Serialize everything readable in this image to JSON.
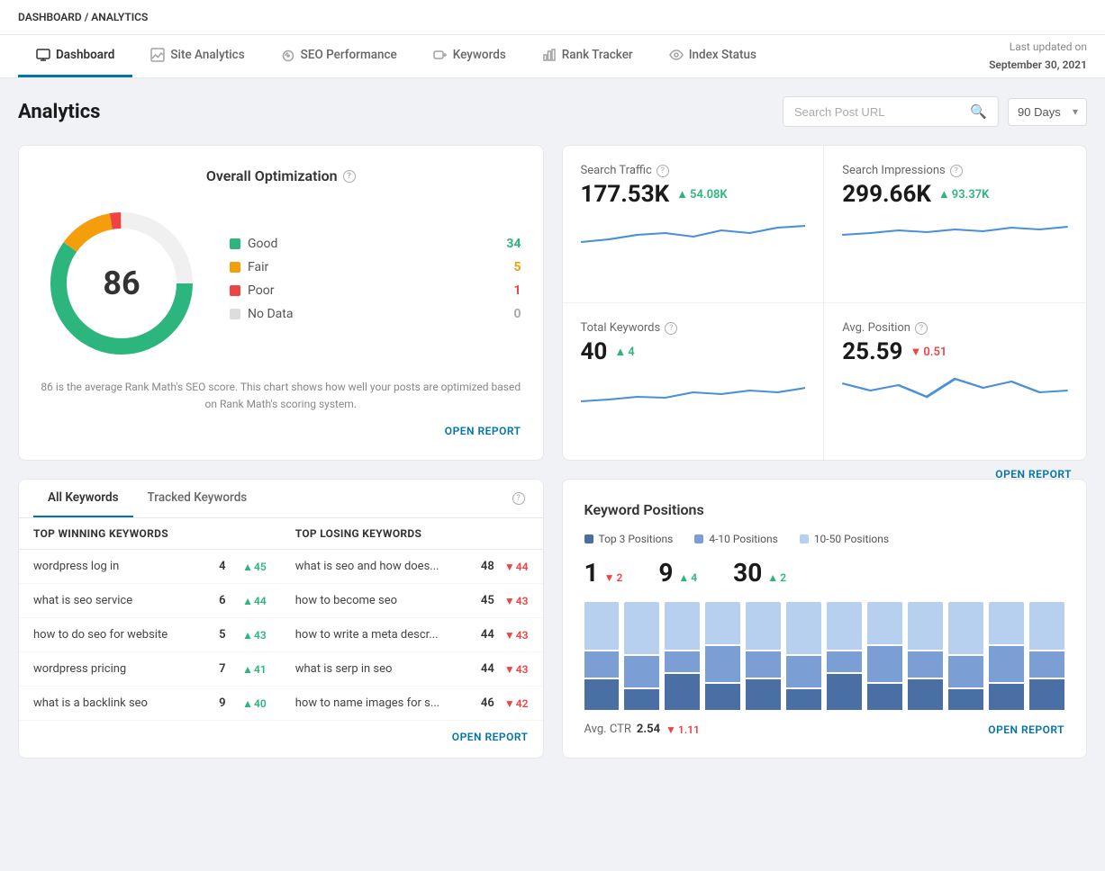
{
  "breadcrumb": {
    "dashboard": "DASHBOARD",
    "separator": "/",
    "current": "ANALYTICS"
  },
  "nav": {
    "tabs": [
      {
        "id": "dashboard",
        "label": "Dashboard",
        "icon": "monitor",
        "active": true
      },
      {
        "id": "site-analytics",
        "label": "Site Analytics",
        "icon": "chart",
        "active": false
      },
      {
        "id": "seo-performance",
        "label": "SEO Performance",
        "icon": "gauge",
        "active": false
      },
      {
        "id": "keywords",
        "label": "Keywords",
        "icon": "key",
        "active": false
      },
      {
        "id": "rank-tracker",
        "label": "Rank Tracker",
        "icon": "bar",
        "active": false
      },
      {
        "id": "index-status",
        "label": "Index Status",
        "icon": "eye",
        "active": false
      }
    ],
    "lastUpdated": {
      "label": "Last updated on",
      "date": "September 30, 2021"
    }
  },
  "page": {
    "title": "Analytics"
  },
  "search": {
    "placeholder": "Search Post URL"
  },
  "daysSelect": {
    "value": "90 Days"
  },
  "optimization": {
    "title": "Overall Optimization",
    "score": "86",
    "legend": [
      {
        "label": "Good",
        "count": "34",
        "color": "#2cb67d",
        "countClass": "green"
      },
      {
        "label": "Fair",
        "count": "5",
        "color": "#f59e0b",
        "countClass": "orange"
      },
      {
        "label": "Poor",
        "count": "1",
        "color": "#ef4444",
        "countClass": "red"
      },
      {
        "label": "No Data",
        "count": "0",
        "color": "#ddd",
        "countClass": "gray"
      }
    ],
    "description": "86 is the average Rank Math's SEO score. This chart shows how well your posts are optimized based on Rank Math's scoring system.",
    "openReport": "OPEN REPORT"
  },
  "searchTraffic": {
    "label": "Search Traffic",
    "value": "177.53K",
    "change": "54.08K",
    "changeDir": "up"
  },
  "searchImpressions": {
    "label": "Search Impressions",
    "value": "299.66K",
    "change": "93.37K",
    "changeDir": "up"
  },
  "totalKeywords": {
    "label": "Total Keywords",
    "value": "40",
    "change": "4",
    "changeDir": "up"
  },
  "avgPosition": {
    "label": "Avg. Position",
    "value": "25.59",
    "change": "0.51",
    "changeDir": "down"
  },
  "openReport": "OPEN REPORT",
  "keywords": {
    "tabs": [
      "All Keywords",
      "Tracked Keywords"
    ],
    "activeTab": 0,
    "winningHeader": "Top Winning Keywords",
    "losingHeader": "Top Losing Keywords",
    "rows": [
      {
        "win": "wordpress log in",
        "winPos": "4",
        "winChange": "45",
        "lose": "what is seo and how does...",
        "losePos": "48",
        "loseChange": "44"
      },
      {
        "win": "what is seo service",
        "winPos": "6",
        "winChange": "44",
        "lose": "how to become seo",
        "losePos": "45",
        "loseChange": "43"
      },
      {
        "win": "how to do seo for website",
        "winPos": "5",
        "winChange": "43",
        "lose": "how to write a meta descr...",
        "losePos": "44",
        "loseChange": "43"
      },
      {
        "win": "wordpress pricing",
        "winPos": "7",
        "winChange": "41",
        "lose": "what is serp in seo",
        "losePos": "44",
        "loseChange": "43"
      },
      {
        "win": "what is a backlink seo",
        "winPos": "9",
        "winChange": "40",
        "lose": "how to name images for s...",
        "losePos": "46",
        "loseChange": "42"
      }
    ],
    "openReport": "OPEN REPORT"
  },
  "keywordPositions": {
    "title": "Keyword Positions",
    "legend": [
      {
        "label": "Top 3 Positions",
        "color": "#4a6fa5"
      },
      {
        "label": "4-10 Positions",
        "color": "#7b9fd4"
      },
      {
        "label": "10-50 Positions",
        "color": "#b8d0f0"
      }
    ],
    "stats": [
      {
        "value": "1",
        "change": "2",
        "dir": "down",
        "label": ""
      },
      {
        "value": "9",
        "change": "4",
        "dir": "up",
        "label": ""
      },
      {
        "value": "30",
        "change": "2",
        "dir": "up",
        "label": ""
      }
    ],
    "bars": [
      {
        "dark": 30,
        "mid": 25,
        "light": 45
      },
      {
        "dark": 20,
        "mid": 30,
        "light": 50
      },
      {
        "dark": 35,
        "mid": 20,
        "light": 45
      },
      {
        "dark": 25,
        "mid": 35,
        "light": 40
      },
      {
        "dark": 30,
        "mid": 25,
        "light": 45
      },
      {
        "dark": 20,
        "mid": 30,
        "light": 50
      },
      {
        "dark": 35,
        "mid": 20,
        "light": 45
      },
      {
        "dark": 25,
        "mid": 35,
        "light": 40
      },
      {
        "dark": 30,
        "mid": 25,
        "light": 45
      },
      {
        "dark": 20,
        "mid": 30,
        "light": 50
      },
      {
        "dark": 25,
        "mid": 35,
        "light": 40
      },
      {
        "dark": 30,
        "mid": 25,
        "light": 45
      }
    ],
    "avgCtr": {
      "label": "Avg. CTR",
      "value": "2.54",
      "change": "1.11",
      "dir": "down"
    },
    "openReport": "OPEN REPORT"
  }
}
